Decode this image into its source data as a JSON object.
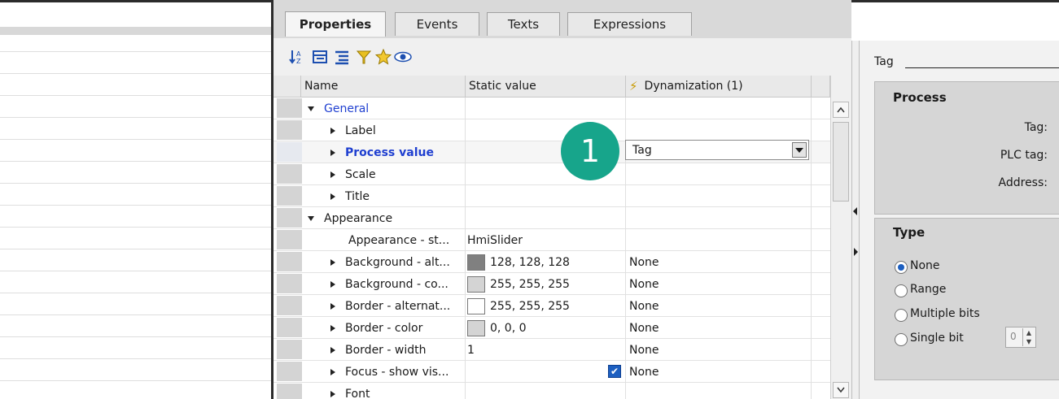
{
  "tabs": [
    {
      "label": "Properties",
      "active": true
    },
    {
      "label": "Events",
      "active": false
    },
    {
      "label": "Texts",
      "active": false
    },
    {
      "label": "Expressions",
      "active": false
    }
  ],
  "toolbar": {
    "icons": [
      "sort-alpha-icon",
      "categorized-icon",
      "expand-icon",
      "filter-icon",
      "favorite-star-icon",
      "visibility-eye-icon"
    ]
  },
  "grid": {
    "columns": {
      "name": "Name",
      "static_value": "Static value",
      "dynamization": "Dynamization (1)"
    },
    "rows": [
      {
        "name": "General",
        "level": 0,
        "expanded": true,
        "highlight": true,
        "static": "",
        "swatch": "",
        "dyn": ""
      },
      {
        "name": "Label",
        "level": 1,
        "expanded": false,
        "highlight": false,
        "static": "",
        "swatch": "",
        "dyn": ""
      },
      {
        "name": "Process value",
        "level": 1,
        "expanded": false,
        "highlight": true,
        "bold": true,
        "static": "",
        "swatch": "",
        "dyn": ""
      },
      {
        "name": "Scale",
        "level": 1,
        "expanded": false,
        "highlight": false,
        "static": "",
        "swatch": "",
        "dyn": ""
      },
      {
        "name": "Title",
        "level": 1,
        "expanded": false,
        "highlight": false,
        "static": "",
        "swatch": "",
        "dyn": ""
      },
      {
        "name": "Appearance",
        "level": 0,
        "expanded": true,
        "highlight": false,
        "static": "",
        "swatch": "",
        "dyn": ""
      },
      {
        "name": "Appearance - st...",
        "level": 2,
        "expanded": null,
        "highlight": false,
        "static": "HmiSlider",
        "swatch": "",
        "dyn": ""
      },
      {
        "name": "Background - alt...",
        "level": 1,
        "expanded": false,
        "highlight": false,
        "static": "128, 128, 128",
        "swatch": "#808080",
        "dyn": "None"
      },
      {
        "name": "Background - co...",
        "level": 1,
        "expanded": false,
        "highlight": false,
        "static": "255, 255, 255",
        "swatch": "#d4d4d4",
        "dyn": "None"
      },
      {
        "name": "Border - alternat...",
        "level": 1,
        "expanded": false,
        "highlight": false,
        "static": "255, 255, 255",
        "swatch": "#ffffff",
        "dyn": "None"
      },
      {
        "name": "Border - color",
        "level": 1,
        "expanded": false,
        "highlight": false,
        "static": "0, 0, 0",
        "swatch": "#d4d4d4",
        "dyn": "None"
      },
      {
        "name": "Border - width",
        "level": 1,
        "expanded": false,
        "highlight": false,
        "static": "1",
        "swatch": "",
        "dyn": "None"
      },
      {
        "name": "Focus - show vis...",
        "level": 1,
        "expanded": false,
        "highlight": false,
        "static": "",
        "swatch": "",
        "checkbox": true,
        "dyn": "None"
      },
      {
        "name": "Font",
        "level": 1,
        "expanded": false,
        "highlight": false,
        "static": "",
        "swatch": "",
        "dyn": ""
      }
    ],
    "dropdown_value": "Tag"
  },
  "callout": "1",
  "right_panel": {
    "tag_label": "Tag",
    "process": {
      "title": "Process",
      "fields": [
        "Tag:",
        "PLC tag:",
        "Address:"
      ]
    },
    "type": {
      "title": "Type",
      "options": [
        {
          "label": "None",
          "checked": true
        },
        {
          "label": "Range",
          "checked": false
        },
        {
          "label": "Multiple bits",
          "checked": false
        },
        {
          "label": "Single bit",
          "checked": false
        }
      ],
      "single_bit_value": "0"
    }
  },
  "colors": {
    "accent": "#1f3fd0",
    "badge": "#17a58b"
  }
}
